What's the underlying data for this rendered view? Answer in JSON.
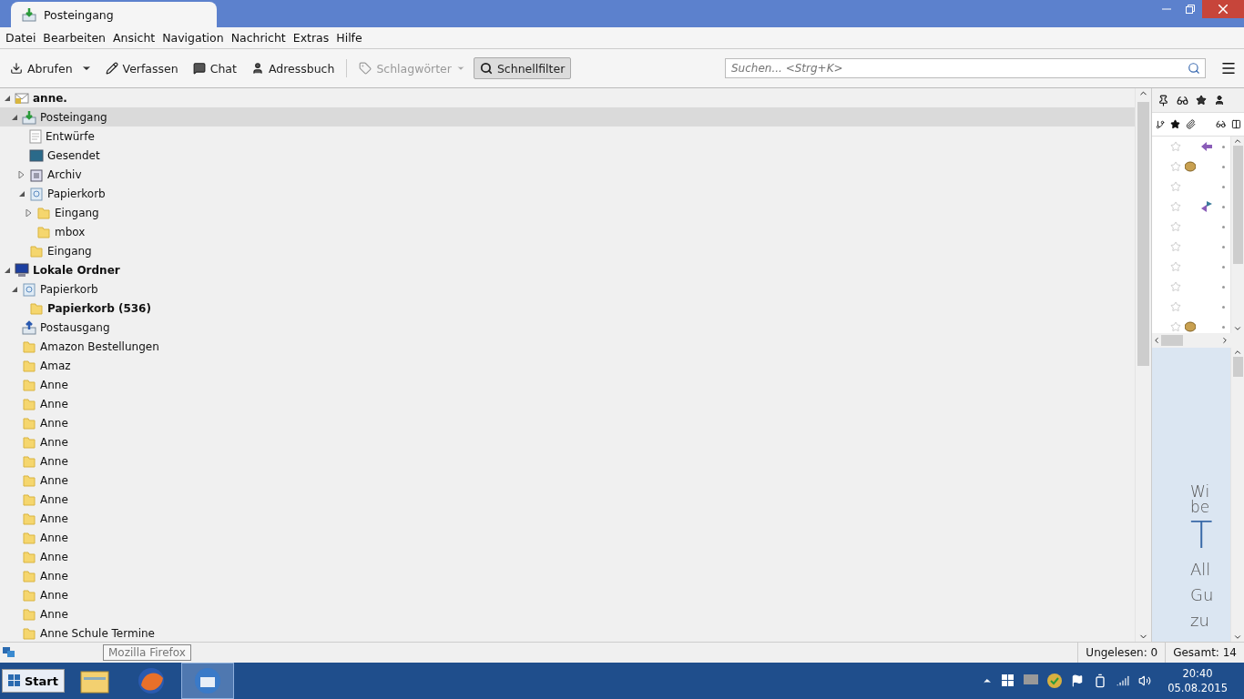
{
  "window": {
    "tab_title": "Posteingang"
  },
  "menu": [
    "Datei",
    "Bearbeiten",
    "Ansicht",
    "Navigation",
    "Nachricht",
    "Extras",
    "Hilfe"
  ],
  "toolbar": [
    {
      "kind": "get",
      "label": "Abrufen",
      "disabled": false,
      "selected": false
    },
    {
      "kind": "compose",
      "label": "Verfassen",
      "disabled": false,
      "selected": false
    },
    {
      "kind": "chat",
      "label": "Chat",
      "disabled": false,
      "selected": false
    },
    {
      "kind": "address",
      "label": "Adressbuch",
      "disabled": false,
      "selected": false
    },
    {
      "kind": "tag",
      "label": "Schlagwörter",
      "disabled": true,
      "selected": false
    },
    {
      "kind": "filter",
      "label": "Schnellfilter",
      "disabled": false,
      "selected": true
    }
  ],
  "search": {
    "placeholder": "Suchen... <Strg+K>"
  },
  "folders": [
    {
      "kind": "account",
      "label": "anne.",
      "unread": true,
      "selected": false,
      "expanded": true,
      "children": [
        {
          "kind": "inbox",
          "label": "Posteingang",
          "unread": false,
          "selected": true,
          "expanded": true,
          "children": [
            {
              "kind": "drafts",
              "label": "Entwürfe",
              "unread": false,
              "selected": false
            },
            {
              "kind": "sent",
              "label": "Gesendet",
              "unread": false,
              "selected": false
            },
            {
              "kind": "archive",
              "label": "Archiv",
              "unread": false,
              "selected": false,
              "expanded": false
            },
            {
              "kind": "trash",
              "label": "Papierkorb",
              "unread": false,
              "selected": false,
              "expanded": true,
              "children": [
                {
                  "kind": "folder",
                  "label": "Eingang",
                  "unread": false,
                  "selected": false,
                  "expanded": false
                },
                {
                  "kind": "folder",
                  "label": "mbox",
                  "unread": false,
                  "selected": false
                }
              ]
            },
            {
              "kind": "folder",
              "label": "Eingang",
              "unread": false,
              "selected": false
            }
          ]
        }
      ]
    },
    {
      "kind": "local",
      "label": "Lokale Ordner",
      "unread": true,
      "selected": false,
      "expanded": true,
      "children": [
        {
          "kind": "trash",
          "label": "Papierkorb",
          "unread": false,
          "selected": false,
          "expanded": true,
          "children": [
            {
              "kind": "folder",
              "label": "Papierkorb (536)",
              "unread": true,
              "selected": false
            }
          ]
        },
        {
          "kind": "outbox",
          "label": "Postausgang",
          "unread": false,
          "selected": false
        },
        {
          "kind": "folder",
          "label": "Amazon Bestellungen",
          "unread": false,
          "selected": false
        },
        {
          "kind": "folder",
          "label": "Amaz",
          "unread": false,
          "selected": false
        },
        {
          "kind": "folder",
          "label": "Anne",
          "unread": false,
          "selected": false
        },
        {
          "kind": "folder",
          "label": "Anne",
          "unread": false,
          "selected": false
        },
        {
          "kind": "folder",
          "label": "Anne",
          "unread": false,
          "selected": false
        },
        {
          "kind": "folder",
          "label": "Anne",
          "unread": false,
          "selected": false
        },
        {
          "kind": "folder",
          "label": "Anne",
          "unread": false,
          "selected": false
        },
        {
          "kind": "folder",
          "label": "Anne",
          "unread": false,
          "selected": false
        },
        {
          "kind": "folder",
          "label": "Anne",
          "unread": false,
          "selected": false
        },
        {
          "kind": "folder",
          "label": "Anne",
          "unread": false,
          "selected": false
        },
        {
          "kind": "folder",
          "label": "Anne",
          "unread": false,
          "selected": false
        },
        {
          "kind": "folder",
          "label": "Anne",
          "unread": false,
          "selected": false
        },
        {
          "kind": "folder",
          "label": "Anne",
          "unread": false,
          "selected": false
        },
        {
          "kind": "folder",
          "label": "Anne",
          "unread": false,
          "selected": false
        },
        {
          "kind": "folder",
          "label": "Anne",
          "unread": false,
          "selected": false
        },
        {
          "kind": "folder",
          "label": "Anne Schule Termine",
          "unread": false,
          "selected": false
        }
      ]
    }
  ],
  "messages": [
    {
      "flagged": false,
      "kind": "replied"
    },
    {
      "flagged": false,
      "kind": "attachment"
    },
    {
      "flagged": false,
      "kind": "plain"
    },
    {
      "flagged": false,
      "kind": "forwarded"
    },
    {
      "flagged": false,
      "kind": "plain"
    },
    {
      "flagged": false,
      "kind": "plain"
    },
    {
      "flagged": false,
      "kind": "plain"
    },
    {
      "flagged": false,
      "kind": "plain"
    },
    {
      "flagged": false,
      "kind": "plain"
    },
    {
      "flagged": false,
      "kind": "attachment"
    }
  ],
  "preview": {
    "lines": [
      {
        "kind": "small",
        "text": "Wi"
      },
      {
        "kind": "small",
        "text": "be"
      },
      {
        "kind": "big",
        "text": "T"
      },
      {
        "kind": "body",
        "text": "All"
      },
      {
        "kind": "body",
        "text": "Gu"
      },
      {
        "kind": "body",
        "text": "zu"
      }
    ]
  },
  "tooltip": "Mozilla Firefox",
  "status_bar": {
    "unread": "Ungelesen: 0",
    "total": "Gesamt: 14"
  },
  "taskbar": {
    "start": "Start",
    "apps": [
      {
        "kind": "explorer",
        "selected": false
      },
      {
        "kind": "firefox",
        "selected": false
      },
      {
        "kind": "thunderbird",
        "selected": true
      }
    ],
    "time": "20:40",
    "date": "05.08.2015"
  }
}
